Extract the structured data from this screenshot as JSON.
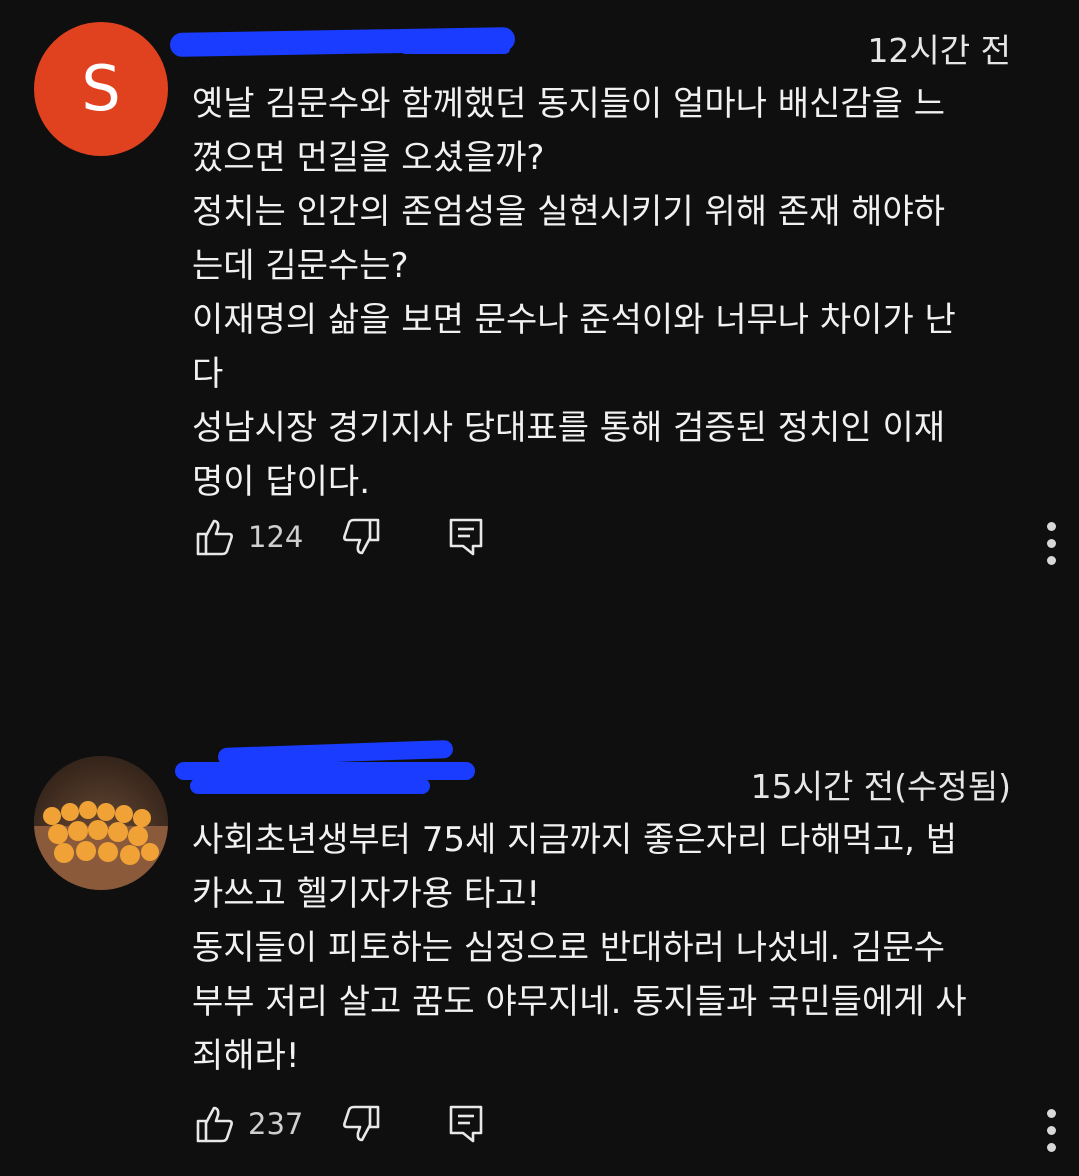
{
  "comments": [
    {
      "avatar_letter": "S",
      "avatar_color": "#e0421f",
      "time": "12시간 전",
      "text": "옛날 김문수와 함께했던 동지들이 얼마나 배신감을 느\n꼈으면 먼길을 오셨을까?\n정치는 인간의 존엄성을 실현시키기 위해 존재 해야하\n는데 김문수는?\n이재명의 삶을 보면 문수나 준석이와 너무나 차이가 난\n다\n성남시장 경기지사 당대표를 통해 검증된 정치인 이재\n명이 답이다.",
      "likes": "124"
    },
    {
      "avatar_image": "food-photo-avatar",
      "time": "15시간 전(수정됨)",
      "text": "사회초년생부터 75세 지금까지 좋은자리 다해먹고, 법\n카쓰고 헬기자가용 타고!\n동지들이 피토하는 심정으로 반대하러 나섰네. 김문수\n부부 저리 살고 꿈도 야무지네. 동지들과 국민들에게 사\n죄해라!",
      "likes": "237"
    }
  ],
  "colors": {
    "background": "#0f0f0f",
    "redaction": "#1a3cff"
  }
}
